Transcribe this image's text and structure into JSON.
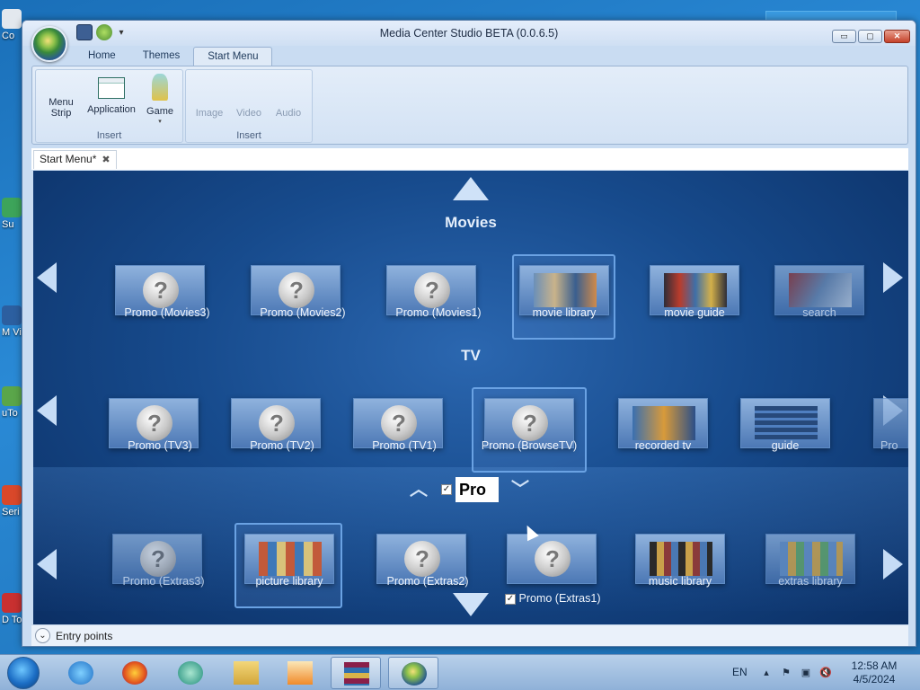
{
  "desktop": {
    "icons": [
      {
        "label": "Co"
      },
      {
        "label": "Su"
      },
      {
        "label": "M Visu"
      },
      {
        "label": "uTo"
      },
      {
        "label": "Seri S"
      },
      {
        "label": "D To"
      }
    ]
  },
  "window": {
    "title": "Media Center Studio BETA (0.0.6.5)",
    "minimize_glyph": "▭",
    "maximize_glyph": "▢",
    "close_glyph": "✕",
    "qat_more_glyph": "▾"
  },
  "ribbon": {
    "tabs": [
      {
        "label": "Home"
      },
      {
        "label": "Themes"
      },
      {
        "label": "Start Menu",
        "active": true
      }
    ],
    "groups": [
      {
        "label": "Insert",
        "buttons": [
          {
            "label": "Menu\nStrip",
            "icon": "menu-strip-icon"
          },
          {
            "label": "Application",
            "icon": "application-icon"
          },
          {
            "label": "Game",
            "icon": "game-icon",
            "dropdown": "▾"
          }
        ]
      },
      {
        "label": "Insert",
        "buttons": [
          {
            "label": "Image",
            "disabled": true
          },
          {
            "label": "Video",
            "disabled": true
          },
          {
            "label": "Audio",
            "disabled": true
          }
        ]
      }
    ]
  },
  "document": {
    "tab_label": "Start Menu*",
    "tab_close": "✖"
  },
  "start_menu": {
    "rows": [
      {
        "title": "Movies",
        "tiles": [
          {
            "label": "Promo (Movies3)",
            "kind": "question"
          },
          {
            "label": "Promo (Movies2)",
            "kind": "question"
          },
          {
            "label": "Promo (Movies1)",
            "kind": "question"
          },
          {
            "label": "movie library",
            "kind": "thumb",
            "selected": true
          },
          {
            "label": "movie guide",
            "kind": "thumb"
          },
          {
            "label": "search",
            "kind": "thumb",
            "dim": true
          }
        ]
      },
      {
        "title": "TV",
        "tiles": [
          {
            "label": "Promo (TV3)",
            "kind": "question"
          },
          {
            "label": "Promo (TV2)",
            "kind": "question"
          },
          {
            "label": "Promo (TV1)",
            "kind": "question"
          },
          {
            "label": "Promo (BrowseTV)",
            "kind": "question",
            "selected": true
          },
          {
            "label": "recorded tv",
            "kind": "thumb"
          },
          {
            "label": "guide",
            "kind": "thumb"
          },
          {
            "label": "Pro",
            "kind": "thumb",
            "dim": true
          }
        ]
      },
      {
        "title_edit": "Pro",
        "tiles": [
          {
            "label": "Promo (Extras3)",
            "kind": "question",
            "dim": true
          },
          {
            "label": "picture library",
            "kind": "thumb",
            "selected": true
          },
          {
            "label": "Promo (Extras2)",
            "kind": "question"
          },
          {
            "label": "Promo (Extras1)",
            "kind": "question",
            "checked": true
          },
          {
            "label": "music library",
            "kind": "thumb"
          },
          {
            "label": "extras library",
            "kind": "thumb",
            "dim": true
          }
        ]
      }
    ],
    "question_glyph": "?",
    "check_glyph": "✓"
  },
  "footer": {
    "toggle_glyph": "⌄",
    "label": "Entry points"
  },
  "taskbar": {
    "language": "EN",
    "tray_glyphs": [
      "▴",
      "⚑",
      "▣",
      "🔇"
    ],
    "time": "12:58 AM",
    "date": "4/5/2024"
  },
  "colors": {
    "canvas_bg": "#174b8d",
    "selection_border": "#6aa2e3",
    "ribbon_bg": "#dfeaf7"
  }
}
